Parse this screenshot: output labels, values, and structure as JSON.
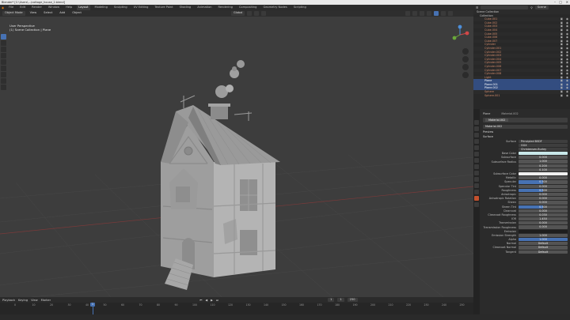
{
  "title_bar": {
    "text": "Blender* [C:\\Users\\...\\cottage_house_2.blend]"
  },
  "menu": {
    "items": [
      "File",
      "Edit",
      "Render",
      "Window",
      "Help"
    ],
    "workspaces": [
      "Layout",
      "Modeling",
      "Sculpting",
      "UV Editing",
      "Texture Paint",
      "Shading",
      "Animation",
      "Rendering",
      "Compositing",
      "Geometry Nodes",
      "Scripting"
    ],
    "active_workspace": "Layout",
    "scene_label": "Scene",
    "view_layer_label": "View Layer"
  },
  "viewport_header": {
    "mode": "Object Mode",
    "menus": [
      "View",
      "Select",
      "Add",
      "Object"
    ],
    "transform": "Global"
  },
  "viewport": {
    "view_name": "User Perspective",
    "collection_path": "(1) Scene Collection | Plane",
    "colors": {
      "background": "#3d3d3d",
      "model": "#a9a9a9",
      "grid": "#484848"
    }
  },
  "timeline": {
    "menus": [
      "Playback",
      "Keying",
      "View",
      "Marker"
    ],
    "current_frame": "1",
    "start": "1",
    "end": "250",
    "ticks": [
      "0",
      "10",
      "20",
      "30",
      "40",
      "50",
      "60",
      "70",
      "80",
      "90",
      "100",
      "110",
      "120",
      "130",
      "140",
      "150",
      "160",
      "170",
      "180",
      "190",
      "200",
      "210",
      "220",
      "230",
      "240",
      "250"
    ]
  },
  "outliner": {
    "search_placeholder": "",
    "root": "Scene Collection",
    "collection": "Collection",
    "items": [
      {
        "name": "Cube.001",
        "selected": false
      },
      {
        "name": "Cube.002",
        "selected": false
      },
      {
        "name": "Cube.003",
        "selected": false
      },
      {
        "name": "Cube.004",
        "selected": false
      },
      {
        "name": "Cube.005",
        "selected": false
      },
      {
        "name": "Cube.006",
        "selected": false
      },
      {
        "name": "Cube.007",
        "selected": false
      },
      {
        "name": "Cylinder",
        "selected": false
      },
      {
        "name": "Cylinder.001",
        "selected": false
      },
      {
        "name": "Cylinder.002",
        "selected": false
      },
      {
        "name": "Cylinder.003",
        "selected": false
      },
      {
        "name": "Cylinder.004",
        "selected": false
      },
      {
        "name": "Cylinder.005",
        "selected": false
      },
      {
        "name": "Cylinder.006",
        "selected": false
      },
      {
        "name": "Cylinder.007",
        "selected": false
      },
      {
        "name": "Cylinder.008",
        "selected": false
      },
      {
        "name": "Light",
        "selected": false
      },
      {
        "name": "Plane",
        "selected": true
      },
      {
        "name": "Plane.001",
        "selected": true
      },
      {
        "name": "Plane.002",
        "selected": true
      },
      {
        "name": "Sphere",
        "selected": false
      },
      {
        "name": "Sphere.001",
        "selected": false
      }
    ]
  },
  "properties": {
    "object_name": "Plane",
    "material_slot": "Material.002",
    "material_name": "Material.002",
    "sections": {
      "preview": "Preview",
      "surface": "Surface"
    },
    "surface_shader": "Principled BSDF",
    "distribution": "GGX",
    "subsurface_method": "Christensen-Burley",
    "rows": [
      {
        "label": "Base Color",
        "value": "",
        "kind": "swatch"
      },
      {
        "label": "Subsurface",
        "value": "0.000",
        "kind": "num"
      },
      {
        "label": "Subsurface Radius",
        "value": "1.000",
        "kind": "num"
      },
      {
        "label": "",
        "value": "0.200",
        "kind": "num"
      },
      {
        "label": "",
        "value": "0.100",
        "kind": "num"
      },
      {
        "label": "Subsurface Color",
        "value": "",
        "kind": "white"
      },
      {
        "label": "Metallic",
        "value": "0.000",
        "kind": "num"
      },
      {
        "label": "Specular",
        "value": "0.500",
        "kind": "bar",
        "fill": 0.5
      },
      {
        "label": "Specular Tint",
        "value": "0.000",
        "kind": "num"
      },
      {
        "label": "Roughness",
        "value": "0.500",
        "kind": "bar",
        "fill": 0.5
      },
      {
        "label": "Anisotropic",
        "value": "0.000",
        "kind": "num"
      },
      {
        "label": "Anisotropic Rotation",
        "value": "0.000",
        "kind": "num"
      },
      {
        "label": "Sheen",
        "value": "0.000",
        "kind": "num"
      },
      {
        "label": "Sheen Tint",
        "value": "0.500",
        "kind": "bar",
        "fill": 0.5
      },
      {
        "label": "Clearcoat",
        "value": "0.000",
        "kind": "num"
      },
      {
        "label": "Clearcoat Roughness",
        "value": "0.030",
        "kind": "num"
      },
      {
        "label": "IOR",
        "value": "1.450",
        "kind": "num"
      },
      {
        "label": "Transmission",
        "value": "0.000",
        "kind": "num"
      },
      {
        "label": "Transmission Roughness",
        "value": "0.000",
        "kind": "num"
      },
      {
        "label": "Emission",
        "value": "",
        "kind": "dark"
      },
      {
        "label": "Emission Strength",
        "value": "1.000",
        "kind": "num"
      },
      {
        "label": "Alpha",
        "value": "1.000",
        "kind": "bar",
        "fill": 1.0
      },
      {
        "label": "Normal",
        "value": "Default",
        "kind": "num"
      },
      {
        "label": "Clearcoat Normal",
        "value": "Default",
        "kind": "num"
      },
      {
        "label": "Tangent",
        "value": "Default",
        "kind": "num"
      }
    ]
  },
  "status_bar": {
    "text": ""
  }
}
